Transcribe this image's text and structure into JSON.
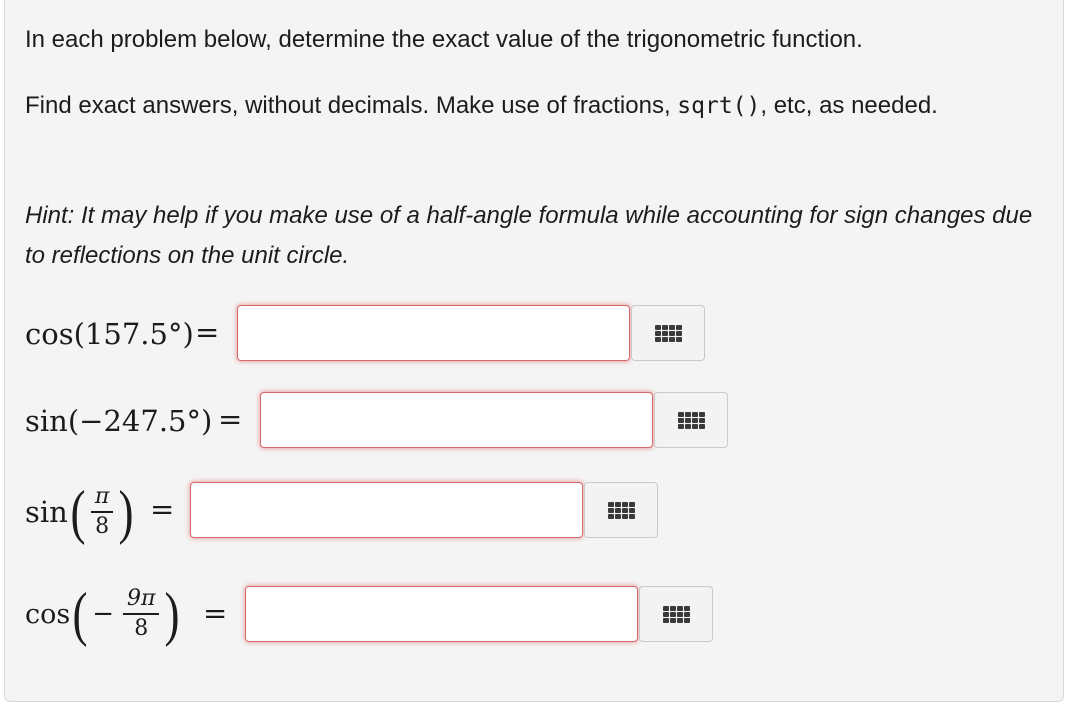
{
  "instructions": {
    "line1": "In each problem below, determine the exact value of the trigonometric function.",
    "line2_prefix": "Find exact answers, without decimals. Make use of fractions, ",
    "line2_code": "sqrt()",
    "line2_suffix": ", etc, as needed.",
    "hint": "Hint: It may help if you make use of a half-angle formula while accounting for sign changes due to reflections on the unit circle."
  },
  "problems": [
    {
      "func": "cos",
      "arg": "157.5°",
      "answer": ""
    },
    {
      "func": "sin",
      "arg": "−247.5°",
      "answer": ""
    },
    {
      "func": "sin",
      "numerator": "π",
      "denominator": "8",
      "answer": ""
    },
    {
      "func": "cos",
      "sign": "−",
      "numerator": "9π",
      "denominator": "8",
      "answer": ""
    }
  ],
  "equals": "=",
  "palette_icon": "keypad-grid-icon"
}
